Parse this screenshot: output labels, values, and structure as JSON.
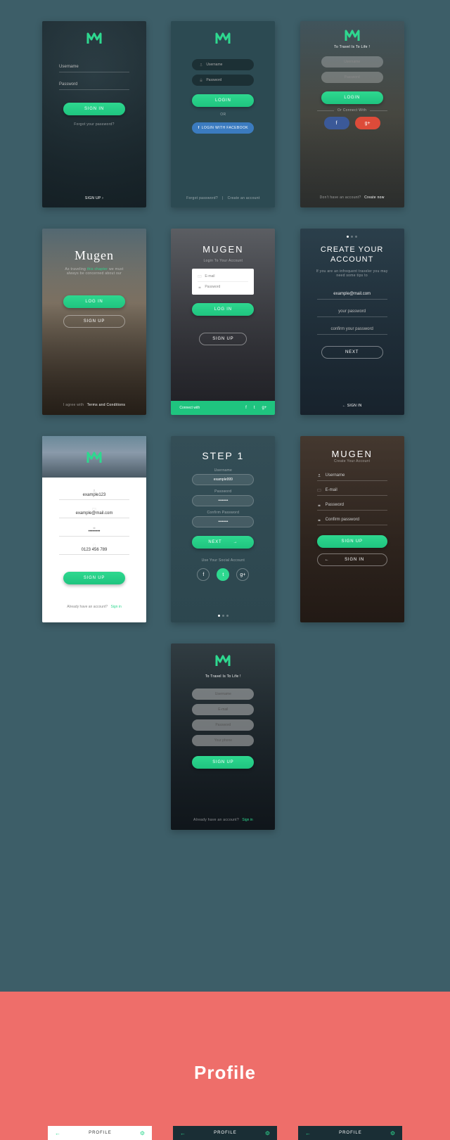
{
  "s1": {
    "user": "Username",
    "pass": "Password",
    "signin": "SIGN IN",
    "forgot": "Forgot your password?",
    "signup": "SIGN UP ›"
  },
  "s2": {
    "user": "Username",
    "pass": "Password",
    "login": "LOGIN",
    "or": "OR",
    "fb": "LOGIN WITH FACEBOOK",
    "forgot": "Forgot password?",
    "sep": "|",
    "create": "Create an account"
  },
  "s3": {
    "tag": "To Travel Is To Life !",
    "user": "Username",
    "pass": "Password",
    "login": "LOGIN",
    "connect": "Or Connect With",
    "fb": "f",
    "gp": "g+",
    "noacct": "Don't have an account?",
    "createnow": "Create now"
  },
  "s4": {
    "title": "Mugen",
    "sub1": "As traveling",
    "sub2": "this chapter",
    "sub3": "we must",
    "sub4": "always be concerned about our",
    "login": "LOG IN",
    "signup": "SIGN UP",
    "agree": "I agree with",
    "terms": "Terms and Conditions"
  },
  "s5": {
    "title": "MUGEN",
    "sub": "Login To Your Account",
    "email": "E-mail",
    "pass": "Password",
    "login": "LOG IN",
    "signup": "SIGN UP",
    "connect": "Connect with",
    "f": "f",
    "t": "t",
    "g": "g+"
  },
  "s6": {
    "title": "CREATE YOUR ACCOUNT",
    "sub": "If you are an infrequent traveler you may need some tips to",
    "email": "example@mail.com",
    "pass": "your password",
    "confirm": "confirm your password",
    "next": "NEXT",
    "signin": "← SIGN IN"
  },
  "s7": {
    "uname_label": "",
    "uname": "example123",
    "email_label": "",
    "email": "example@mail.com",
    "pass": "••••••••",
    "phone": "0123 456 789",
    "signup": "SIGN UP",
    "already": "Already have an account?",
    "signin": "Sign in"
  },
  "s8": {
    "title": "STEP 1",
    "uname_label": "Username",
    "uname": "example999",
    "pass_label": "Password",
    "pass": "••••••••",
    "conf_label": "Confirm Password",
    "conf": "••••••••",
    "next": "NEXT",
    "social": "Use Your Social Account",
    "f": "f",
    "t": "t",
    "g": "g+"
  },
  "s9": {
    "title": "MUGEN",
    "sub": "Create Your Account",
    "user": "Username",
    "email": "E-mail",
    "pass": "Password",
    "confirm": "Confirm password",
    "signup": "SIGN UP",
    "signin": "SIGN IN"
  },
  "s10": {
    "tag": "To Travel Is To Life !",
    "user": "Username",
    "email": "E-mail",
    "pass": "Password",
    "phone": "Your phone",
    "signup": "SIGN UP",
    "already": "Already have an account?",
    "signin": "Sign in"
  },
  "profile": {
    "title": "Profile",
    "label": "PROFILE"
  }
}
